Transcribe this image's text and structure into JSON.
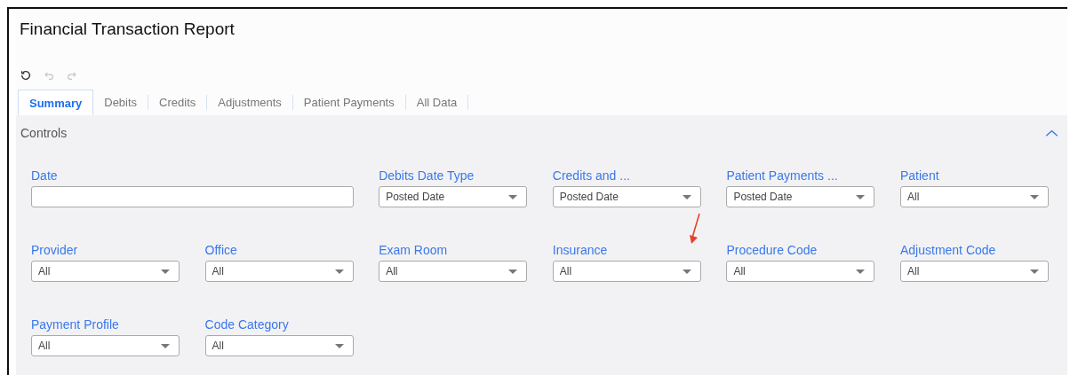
{
  "title": "Financial Transaction Report",
  "toolbar": [
    {
      "kind": "reset",
      "disabled": false
    },
    {
      "kind": "undo",
      "disabled": true
    },
    {
      "kind": "redo",
      "disabled": true
    }
  ],
  "tabs": [
    {
      "label": "Summary",
      "selected": true
    },
    {
      "label": "Debits",
      "selected": false
    },
    {
      "label": "Credits",
      "selected": false
    },
    {
      "label": "Adjustments",
      "selected": false
    },
    {
      "label": "Patient Payments",
      "selected": false
    },
    {
      "label": "All Data",
      "selected": false
    }
  ],
  "controls": {
    "title": "Controls",
    "expanded": true,
    "fields": [
      {
        "kind": "text",
        "label": "Date",
        "marked": false
      },
      {
        "kind": "select",
        "label": "Debits Date Type",
        "value": "Posted Date",
        "marked": false
      },
      {
        "kind": "select",
        "label": "Credits and ...",
        "value": "Posted Date",
        "marked": false
      },
      {
        "kind": "select",
        "label": "Patient Payments ...",
        "value": "Posted Date",
        "marked": false
      },
      {
        "kind": "select",
        "label": "Patient",
        "value": "All",
        "marked": false
      },
      {
        "kind": "select",
        "label": "Provider",
        "value": "All",
        "marked": false
      },
      {
        "kind": "select",
        "label": "Office",
        "value": "All",
        "marked": false
      },
      {
        "kind": "select",
        "label": "Exam Room",
        "value": "All",
        "marked": false
      },
      {
        "kind": "select",
        "label": "Insurance",
        "value": "All",
        "marked": true
      },
      {
        "kind": "select",
        "label": "Procedure Code",
        "value": "All",
        "marked": false
      },
      {
        "kind": "select",
        "label": "Adjustment Code",
        "value": "All",
        "marked": false
      },
      {
        "kind": "select",
        "label": "Payment Profile",
        "value": "All",
        "marked": false
      },
      {
        "kind": "select",
        "label": "Code Category",
        "value": "All",
        "marked": false
      }
    ]
  }
}
